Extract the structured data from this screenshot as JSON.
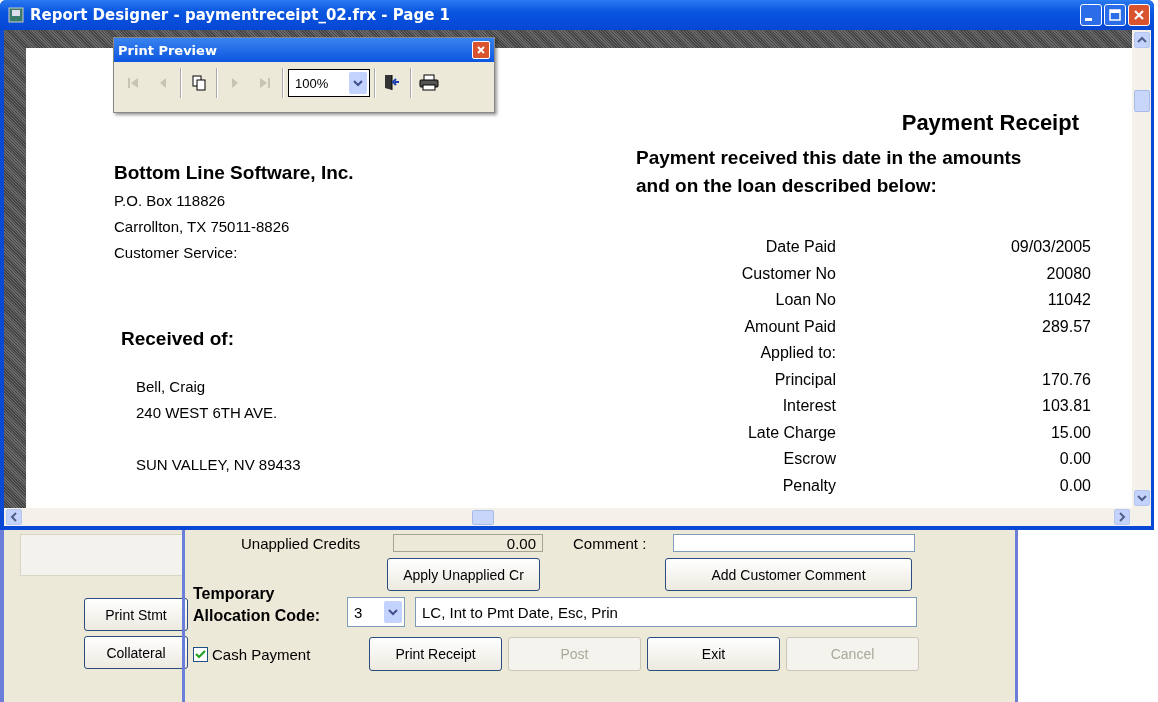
{
  "window": {
    "title": "Report Designer - paymentreceipt_02.frx - Page 1"
  },
  "print_preview": {
    "title": "Print Preview",
    "zoom": "100%",
    "tools": [
      {
        "kind": "first",
        "disabled": true
      },
      {
        "kind": "prev",
        "disabled": true
      },
      {
        "kind": "pages",
        "disabled": false
      },
      {
        "kind": "next",
        "disabled": true
      },
      {
        "kind": "last",
        "disabled": true
      },
      {
        "kind": "zoom",
        "disabled": false
      },
      {
        "kind": "close",
        "disabled": false
      },
      {
        "kind": "print",
        "disabled": false
      }
    ]
  },
  "report": {
    "title": "Payment Receipt",
    "subtitle": [
      "Payment received this date in the amounts",
      "and on the loan described below:"
    ],
    "company": {
      "name": "Bottom Line Software, Inc.",
      "lines": [
        "P.O. Box 118826",
        "Carrollton,  TX 75011-8826",
        "Customer Service:"
      ]
    },
    "received_of": {
      "heading": "Received of:",
      "lines": [
        "Bell, Craig",
        "240 WEST 6TH AVE."
      ],
      "city": "SUN VALLEY, NV 89433"
    },
    "details": [
      {
        "label": "Date Paid",
        "value": "09/03/2005"
      },
      {
        "label": "Customer No",
        "value": "20080"
      },
      {
        "label": "Loan No",
        "value": "11042"
      },
      {
        "label": "Amount Paid",
        "value": "289.57"
      },
      {
        "label": "Applied to:"
      },
      {
        "label": "Principal",
        "value": "170.76"
      },
      {
        "label": "Interest",
        "value": "103.81"
      },
      {
        "label": "Late Charge",
        "value": "15.00"
      },
      {
        "label": "Escrow",
        "value": "0.00"
      },
      {
        "label": "Penalty",
        "value": "0.00"
      }
    ]
  },
  "side_buttons": [
    "Print Stmt",
    "Collateral"
  ],
  "form": {
    "unapplied_credits": {
      "label": "Unapplied Credits",
      "value": "0.00"
    },
    "comment": {
      "label": "Comment :"
    },
    "apply_button": "Apply Unapplied Cr",
    "comment_button": "Add Customer Comment",
    "allocation": {
      "label_lines": [
        "Temporary",
        "Allocation Code:"
      ],
      "code": "3",
      "description": "LC, Int to Pmt Date, Esc, Prin"
    },
    "cash_payment": {
      "label": "Cash Payment",
      "checked": true
    },
    "actions": [
      {
        "label": "Print Receipt",
        "disabled": false
      },
      {
        "label": "Post",
        "disabled": true
      },
      {
        "label": "Exit",
        "disabled": false
      },
      {
        "label": "Cancel",
        "disabled": true
      }
    ]
  }
}
